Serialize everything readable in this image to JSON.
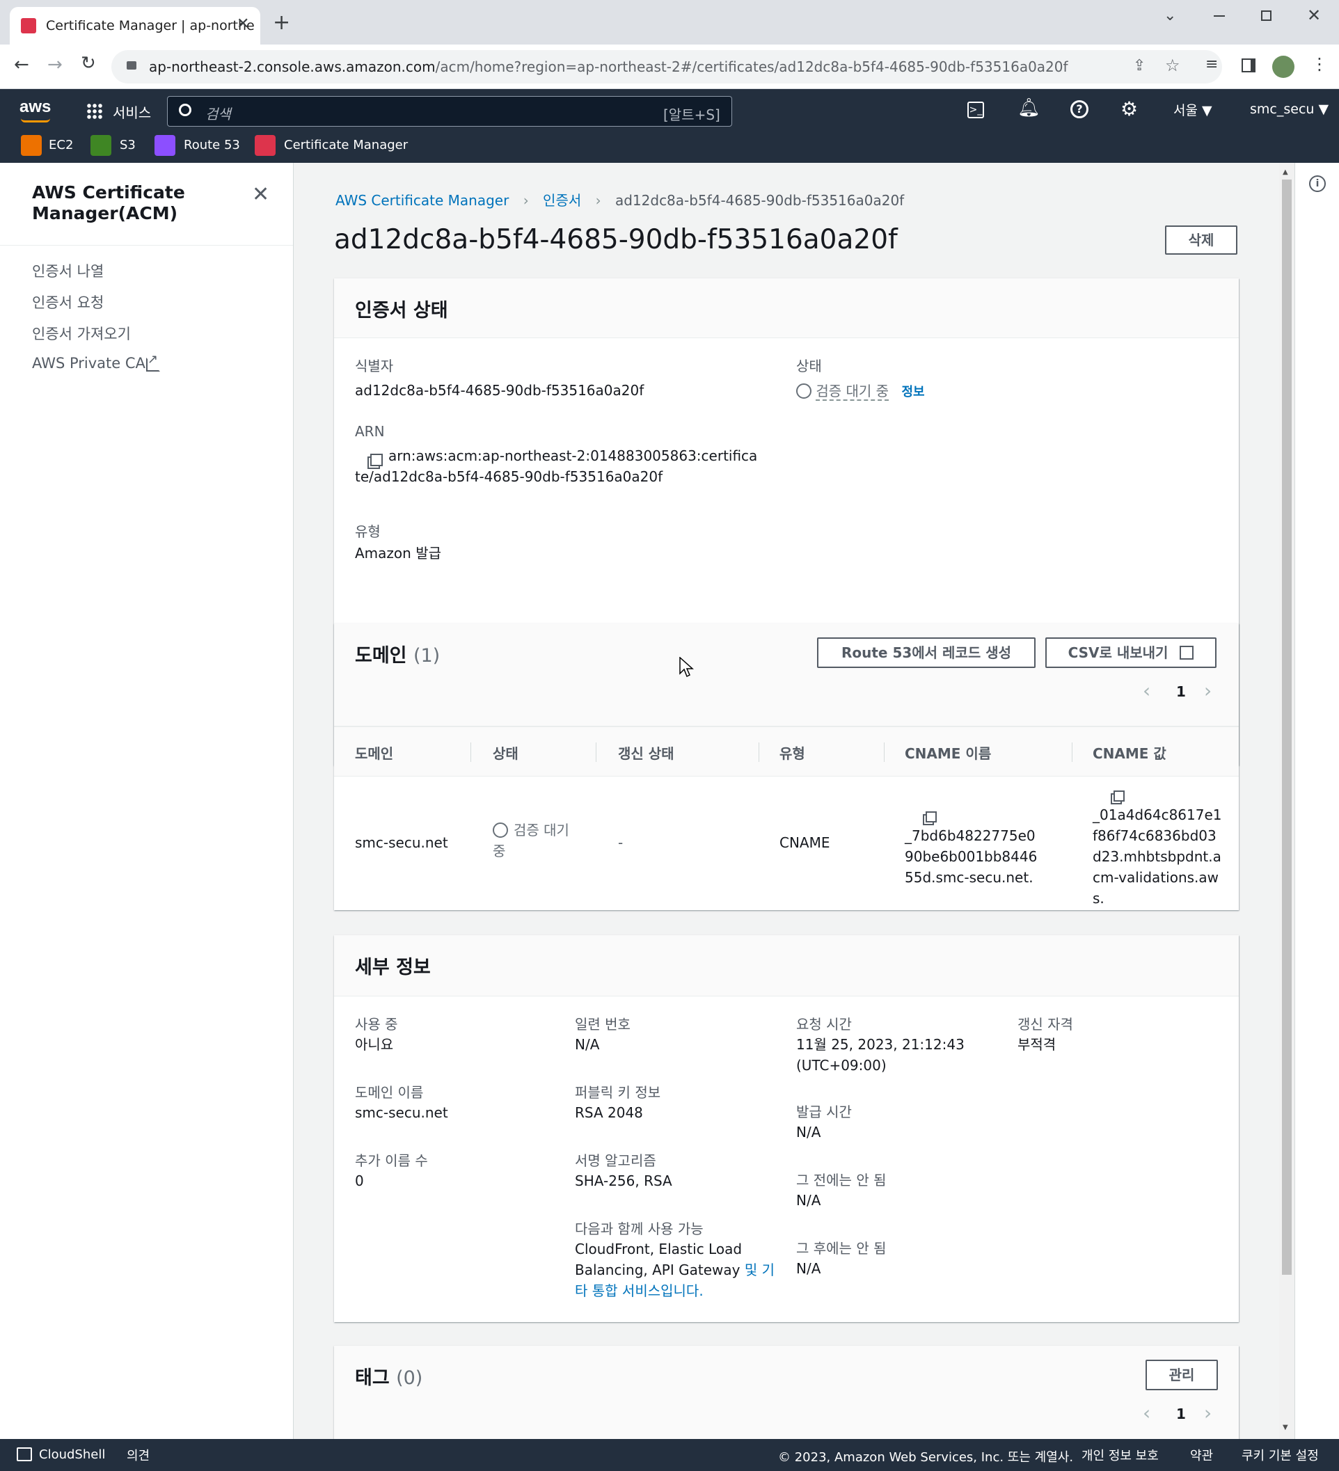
{
  "browser": {
    "tab_title": "Certificate Manager | ap-northe",
    "url_host": "ap-northeast-2.console.aws.amazon.com",
    "url_path": "/acm/home?region=ap-northeast-2#/certificates/ad12dc8a-b5f4-4685-90db-f53516a0a20f"
  },
  "aws_header": {
    "services_label": "서비스",
    "search_placeholder": "검색",
    "search_shortcut": "[알트+S]",
    "region": "서울 ▼",
    "account": "smc_secu ▼",
    "favorites": [
      {
        "label": "EC2",
        "color": "#ed7100"
      },
      {
        "label": "S3",
        "color": "#3f8624"
      },
      {
        "label": "Route 53",
        "color": "#8c4fff"
      },
      {
        "label": "Certificate Manager",
        "color": "#dd344c"
      }
    ]
  },
  "sidebar": {
    "title": "AWS Certificate Manager(ACM)",
    "items": [
      {
        "label": "인증서 나열"
      },
      {
        "label": "인증서 요청"
      },
      {
        "label": "인증서 가져오기"
      },
      {
        "label": "AWS Private CA"
      }
    ]
  },
  "breadcrumb": {
    "root": "AWS Certificate Manager",
    "section": "인증서",
    "current": "ad12dc8a-b5f4-4685-90db-f53516a0a20f"
  },
  "page": {
    "title": "ad12dc8a-b5f4-4685-90db-f53516a0a20f",
    "delete_label": "삭제"
  },
  "status_card": {
    "title": "인증서 상태",
    "identifier_label": "식별자",
    "identifier_value": "ad12dc8a-b5f4-4685-90db-f53516a0a20f",
    "arn_label": "ARN",
    "arn_value": "arn:aws:acm:ap-northeast-2:014883005863:certificate/ad12dc8a-b5f4-4685-90db-f53516a0a20f",
    "type_label": "유형",
    "type_value": "Amazon 발급",
    "status_label": "상태",
    "status_value": "검증 대기 중",
    "info_link": "정보"
  },
  "domain_card": {
    "title": "도메인",
    "count": "(1)",
    "route53_button": "Route 53에서 레코드 생성",
    "csv_button": "CSV로 내보내기",
    "page": "1",
    "columns": [
      "도메인",
      "상태",
      "갱신 상태",
      "유형",
      "CNAME 이름",
      "CNAME 값"
    ],
    "rows": [
      {
        "domain": "smc-secu.net",
        "status": "검증 대기 중",
        "renewal": "-",
        "type": "CNAME",
        "cname_name": "_7bd6b4822775e090be6b001bb844655d.smc-secu.net.",
        "cname_value": "_01a4d64c8617e1f86f74c6836bd03d23.mhbtsbpdnt.acm-validations.aws."
      }
    ]
  },
  "details_card": {
    "title": "세부 정보",
    "in_use_label": "사용 중",
    "in_use_value": "아니요",
    "domain_name_label": "도메인 이름",
    "domain_name_value": "smc-secu.net",
    "additional_names_label": "추가 이름 수",
    "additional_names_value": "0",
    "serial_label": "일련 번호",
    "serial_value": "N/A",
    "public_key_label": "퍼블릭 키 정보",
    "public_key_value": "RSA 2048",
    "sig_alg_label": "서명 알고리즘",
    "sig_alg_value": "SHA-256, RSA",
    "usable_with_label": "다음과 함께 사용 가능",
    "usable_with_value": "CloudFront, Elastic Load Balancing, API Gateway ",
    "usable_with_link": "및 기타 통합 서비스입니다.",
    "requested_label": "요청 시간",
    "requested_value": "11월 25, 2023, 21:12:43 (UTC+09:00)",
    "issued_label": "발급 시간",
    "issued_value": "N/A",
    "not_before_label": "그 전에는 안 됨",
    "not_before_value": "N/A",
    "not_after_label": "그 후에는 안 됨",
    "not_after_value": "N/A",
    "renewal_label": "갱신 자격",
    "renewal_value": "부적격"
  },
  "tags_card": {
    "title": "태그",
    "count": "(0)",
    "manage_label": "관리",
    "page": "1"
  },
  "footer": {
    "cloudshell": "CloudShell",
    "feedback": "의견",
    "copyright": "© 2023, Amazon Web Services, Inc. 또는 계열사.",
    "privacy": "개인 정보 보호",
    "terms": "약관",
    "cookies": "쿠키 기본 설정"
  }
}
